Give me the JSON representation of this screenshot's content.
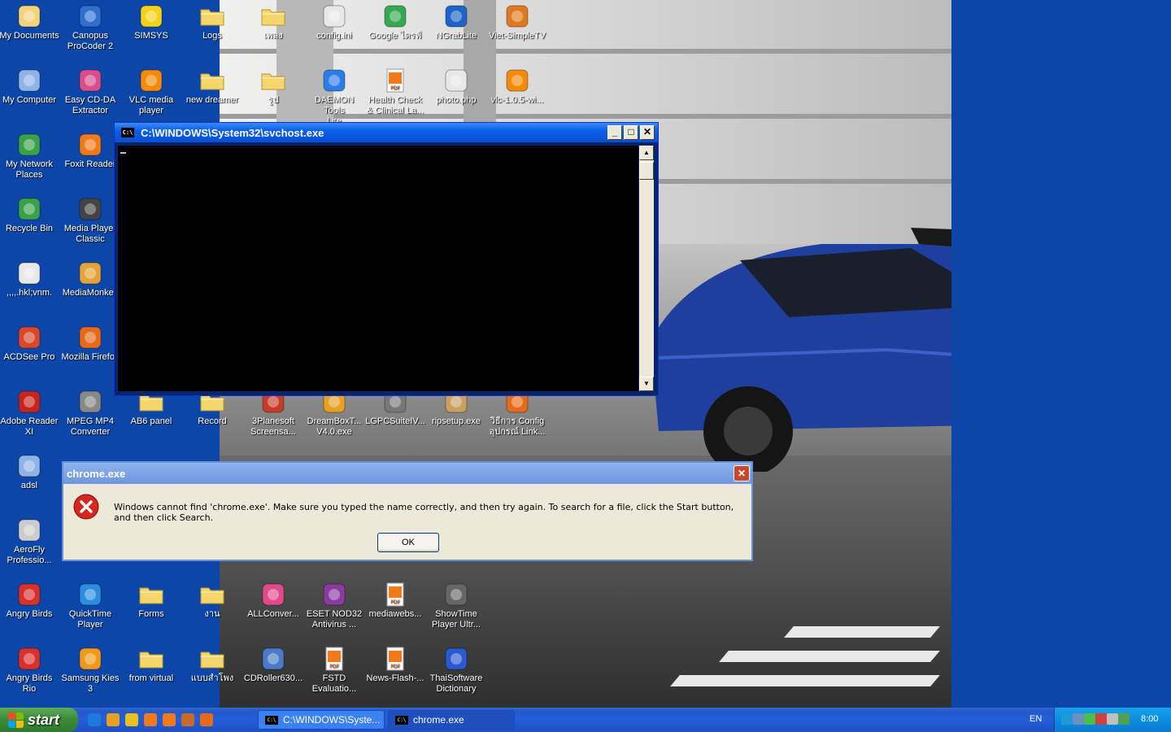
{
  "desktop_icons": [
    {
      "label": "My Documents",
      "icon": "my-documents-icon",
      "color": "#f4d27a"
    },
    {
      "label": "Canopus\nProCoder 2",
      "icon": "procoder-icon",
      "color": "#2f6fd0"
    },
    {
      "label": "SIMSYS",
      "icon": "hardhat-icon",
      "color": "#f2d21a"
    },
    {
      "label": "Logs",
      "icon": "folder-icon",
      "color": "#f3d66c"
    },
    {
      "label": "เพลง",
      "icon": "folder-icon",
      "color": "#f3d66c"
    },
    {
      "label": "config.ini",
      "icon": "ini-file-icon",
      "color": "#e8e8e8"
    },
    {
      "label": "Google ไดรฟ์",
      "icon": "google-drive-icon",
      "color": "#34a853"
    },
    {
      "label": "NGrabLite",
      "icon": "ngrab-icon",
      "color": "#1e63c6"
    },
    {
      "label": "Viet-SimpleTV",
      "icon": "tv-icon",
      "color": "#e07a1e"
    },
    {
      "label": "My Computer",
      "icon": "my-computer-icon",
      "color": "#8fb3e6"
    },
    {
      "label": "Easy CD-DA\nExtractor",
      "icon": "cd-icon",
      "color": "#d94d8a"
    },
    {
      "label": "VLC media\nplayer",
      "icon": "vlc-icon",
      "color": "#f28a0a"
    },
    {
      "label": "new dreamer",
      "icon": "folder-icon",
      "color": "#f3d66c"
    },
    {
      "label": "รูป",
      "icon": "folder-icon",
      "color": "#f3d66c"
    },
    {
      "label": "DAEMON Tools\nLite",
      "icon": "daemon-tools-icon",
      "color": "#2b7de9"
    },
    {
      "label": "Health Check\n& Clinical La...",
      "icon": "pdf-icon",
      "color": "#f07a1a"
    },
    {
      "label": "photo.php",
      "icon": "php-file-icon",
      "color": "#e8e8e8"
    },
    {
      "label": "vlc-1.0.5-wi...",
      "icon": "vlc-icon",
      "color": "#f28a0a"
    },
    {
      "label": "My Network\nPlaces",
      "icon": "network-icon",
      "color": "#3aa04a"
    },
    {
      "label": "Foxit Reader",
      "icon": "foxit-icon",
      "color": "#f07a1a"
    },
    {
      "label": "Recycle Bin",
      "icon": "recycle-bin-icon",
      "color": "#3aa04a"
    },
    {
      "label": "Media Player\nClassic",
      "icon": "clapper-icon",
      "color": "#444444"
    },
    {
      "label": ",,,,.hkl;vnm.",
      "icon": "window-app-icon",
      "color": "#e8e8e8"
    },
    {
      "label": "MediaMonkey",
      "icon": "mediamonkey-icon",
      "color": "#e2a33a"
    },
    {
      "label": "ACDSee Pro",
      "icon": "acdsee-icon",
      "color": "#d8482a"
    },
    {
      "label": "Mozilla Firefox",
      "icon": "firefox-icon",
      "color": "#e66a1a"
    },
    {
      "label": "Adobe Reader\nXI",
      "icon": "adobe-reader-icon",
      "color": "#c8231b"
    },
    {
      "label": "MPEG MP4\nConverter",
      "icon": "film-reel-icon",
      "color": "#888888"
    },
    {
      "label": "AB6 panel",
      "icon": "folder-icon",
      "color": "#f3d66c"
    },
    {
      "label": "Record",
      "icon": "folder-icon",
      "color": "#f3d66c"
    },
    {
      "label": "3Planesoft\nScreensa...",
      "icon": "screensaver-icon",
      "color": "#c83a2a"
    },
    {
      "label": "DreamBoxT...\nV4.0.exe",
      "icon": "power-icon",
      "color": "#e8a020"
    },
    {
      "label": "LGPCSuiteIV...",
      "icon": "lg-suite-icon",
      "color": "#777777"
    },
    {
      "label": "ripsetup.exe",
      "icon": "package-icon",
      "color": "#c8a060"
    },
    {
      "label": "วิธีการ Config\nอุปกรณ์ Link...",
      "icon": "firefox-icon",
      "color": "#e66a1a"
    },
    {
      "label": "adsl",
      "icon": "network-computer-icon",
      "color": "#8fb3e6"
    },
    {
      "label": "AeroFly\nProfessio...",
      "icon": "aerofly-icon",
      "color": "#cccccc"
    },
    {
      "label": "Angry Birds",
      "icon": "angry-birds-icon",
      "color": "#d8302a"
    },
    {
      "label": "QuickTime\nPlayer",
      "icon": "quicktime-icon",
      "color": "#2b8de0"
    },
    {
      "label": "Forms",
      "icon": "folder-icon",
      "color": "#f3d66c"
    },
    {
      "label": "งาน",
      "icon": "folder-icon",
      "color": "#f3d66c"
    },
    {
      "label": "ALLConver...",
      "icon": "allconverter-icon",
      "color": "#e04a8a"
    },
    {
      "label": "ESET NOD32\nAntivirus ...",
      "icon": "winrar-icon",
      "color": "#8a3aa0"
    },
    {
      "label": "mediawebs...",
      "icon": "pdf-icon",
      "color": "#f07a1a"
    },
    {
      "label": "ShowTime\nPlayer Ultr...",
      "icon": "showtime-icon",
      "color": "#666666"
    },
    {
      "label": "Angry Birds\nRio",
      "icon": "angry-birds-icon",
      "color": "#d8302a"
    },
    {
      "label": "Samsung Kies\n3",
      "icon": "kies-icon",
      "color": "#f09a1a"
    },
    {
      "label": "from virtual",
      "icon": "folder-icon",
      "color": "#f3d66c"
    },
    {
      "label": "แบบสำโพง",
      "icon": "folder-icon",
      "color": "#f3d66c"
    },
    {
      "label": "CDRoller630...",
      "icon": "cdroller-icon",
      "color": "#4a7ac8"
    },
    {
      "label": "FSTD\nEvaluatio...",
      "icon": "pdf-icon",
      "color": "#f07a1a"
    },
    {
      "label": "News-Flash-...",
      "icon": "pdf-icon",
      "color": "#f07a1a"
    },
    {
      "label": "ThaiSoftware\nDictionary",
      "icon": "globe-icon",
      "color": "#2a5ad0"
    }
  ],
  "console": {
    "title": "C:\\WINDOWS\\System32\\svchost.exe",
    "icon_text": "C:\\",
    "min_label": "_",
    "max_label": "□",
    "close_label": "✕"
  },
  "dialog": {
    "title": "chrome.exe",
    "close_label": "✕",
    "message": "Windows cannot find 'chrome.exe'. Make sure you typed the name correctly, and then try again. To search for a file, click the Start button, and then click Search.",
    "ok_label": "OK"
  },
  "taskbar": {
    "start_label": "start",
    "quick_launch": [
      "ie-icon",
      "chrome-icon",
      "media-icon",
      "foxit-icon",
      "foxit-pdf-icon",
      "show-desktop-icon",
      "firefox-icon"
    ],
    "buttons": [
      {
        "label": "C:\\WINDOWS\\Syste...",
        "icon_text": "C:\\",
        "active": false
      },
      {
        "label": "chrome.exe",
        "icon_text": "C:\\",
        "active": true
      }
    ],
    "language": "EN",
    "tray_icons": [
      "skype-icon",
      "network-tray-icon",
      "wireless-icon",
      "volume-icon",
      "security-icon",
      "safely-remove-icon"
    ],
    "clock": "8:00"
  }
}
